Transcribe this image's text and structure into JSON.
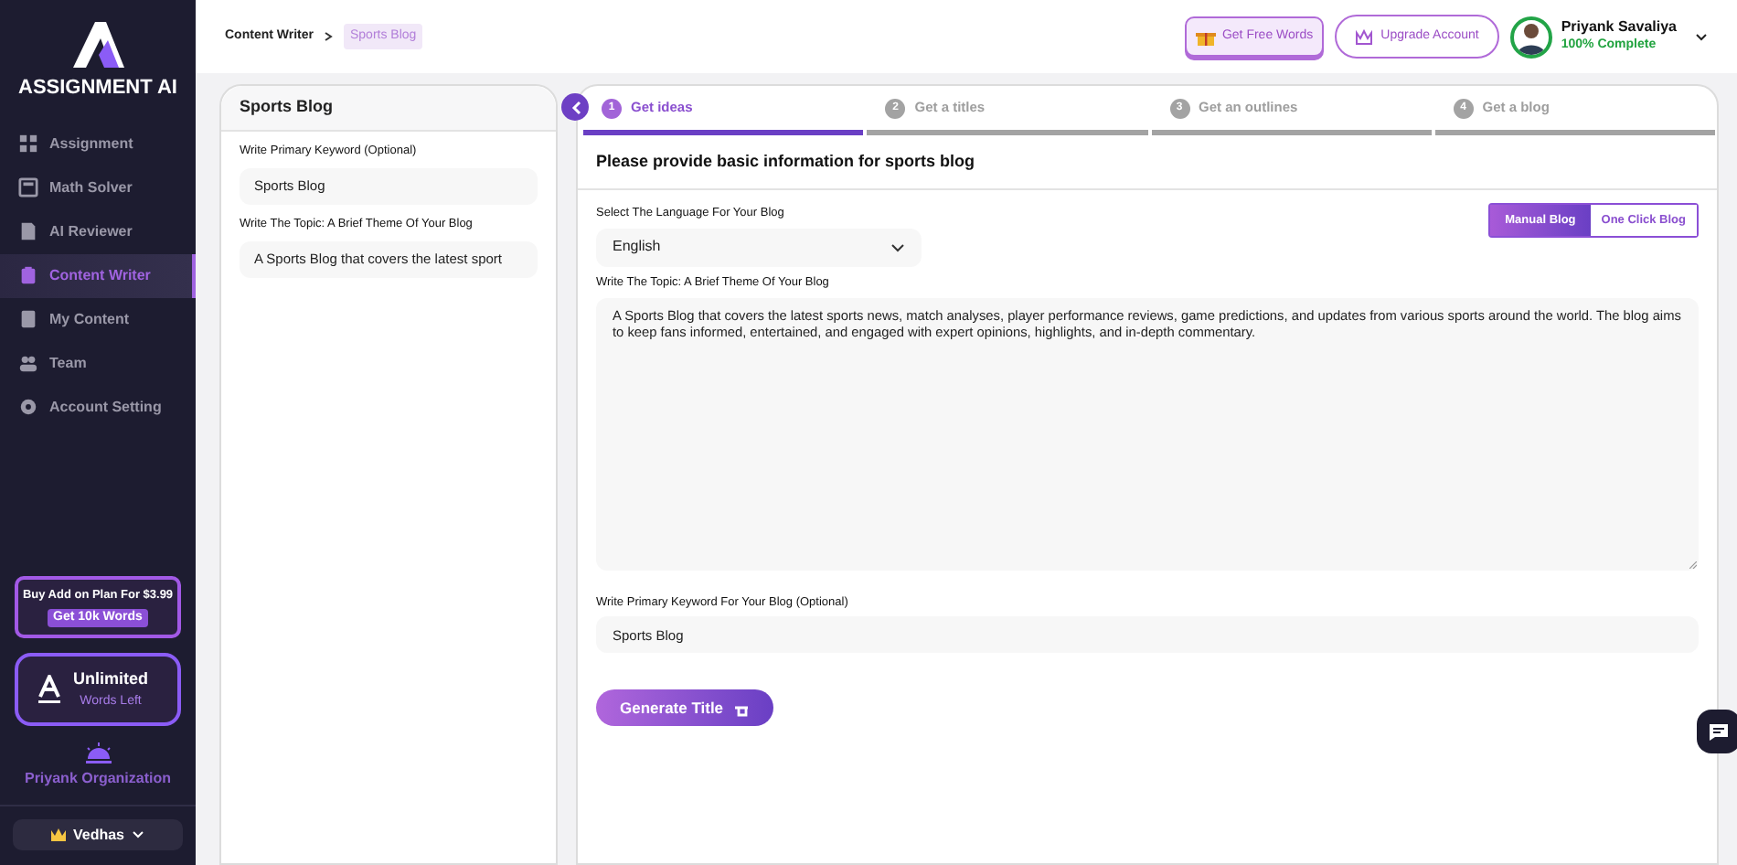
{
  "brand": {
    "name": "ASSIGNMENT AI"
  },
  "nav": [
    {
      "label": "Assignment",
      "kind": "grid",
      "selected": false
    },
    {
      "label": "Math Solver",
      "kind": "calc",
      "selected": false
    },
    {
      "label": "AI Reviewer",
      "kind": "doc",
      "selected": false
    },
    {
      "label": "Content Writer",
      "kind": "clip",
      "selected": true
    },
    {
      "label": "My Content",
      "kind": "book",
      "selected": false
    },
    {
      "label": "Team",
      "kind": "team",
      "selected": false
    },
    {
      "label": "Account Setting",
      "kind": "gear",
      "selected": false
    }
  ],
  "promo": {
    "text": "Buy Add on Plan For $3.99",
    "button": "Get 10k Words"
  },
  "words": {
    "value": "Unlimited",
    "caption": "Words Left"
  },
  "organization": "Priyank Organization",
  "workspace": "Vedhas",
  "breadcrumb": [
    {
      "label": "Content Writer",
      "selected": false
    },
    {
      "label": "Sports Blog",
      "selected": true
    }
  ],
  "header": {
    "free_words": "Get Free Words",
    "upgrade": "Upgrade Account",
    "user": {
      "name": "Priyank Savaliya",
      "progress": "100% Complete",
      "complete": true
    }
  },
  "summary": {
    "title": "Sports Blog",
    "fields": [
      {
        "label": "Write Primary Keyword (Optional)",
        "value": "Sports Blog"
      },
      {
        "label": "Write The Topic: A Brief Theme Of Your Blog",
        "value": "A Sports Blog that covers the latest sport"
      }
    ]
  },
  "steps": [
    {
      "number": "1",
      "label": "Get ideas",
      "selected": true
    },
    {
      "number": "2",
      "label": "Get a titles",
      "selected": false
    },
    {
      "number": "3",
      "label": "Get an outlines",
      "selected": false
    },
    {
      "number": "4",
      "label": "Get a blog",
      "selected": false
    }
  ],
  "form": {
    "heading": "Please provide basic information for sports blog",
    "language": {
      "label": "Select The Language For Your Blog",
      "value": "English"
    },
    "modes": [
      {
        "label": "Manual Blog",
        "selected": true
      },
      {
        "label": "One Click Blog",
        "selected": false
      }
    ],
    "topic": {
      "label": "Write The Topic: A Brief Theme Of Your Blog",
      "value": "A Sports Blog that covers the latest sports news, match analyses, player performance reviews, game predictions, and updates from various sports around the world. The blog aims to keep fans informed, entertained, and engaged with expert opinions, highlights, and in-depth commentary."
    },
    "keyword": {
      "label": "Write Primary Keyword For Your Blog (Optional)",
      "value": "Sports Blog"
    },
    "submit": "Generate Title"
  }
}
